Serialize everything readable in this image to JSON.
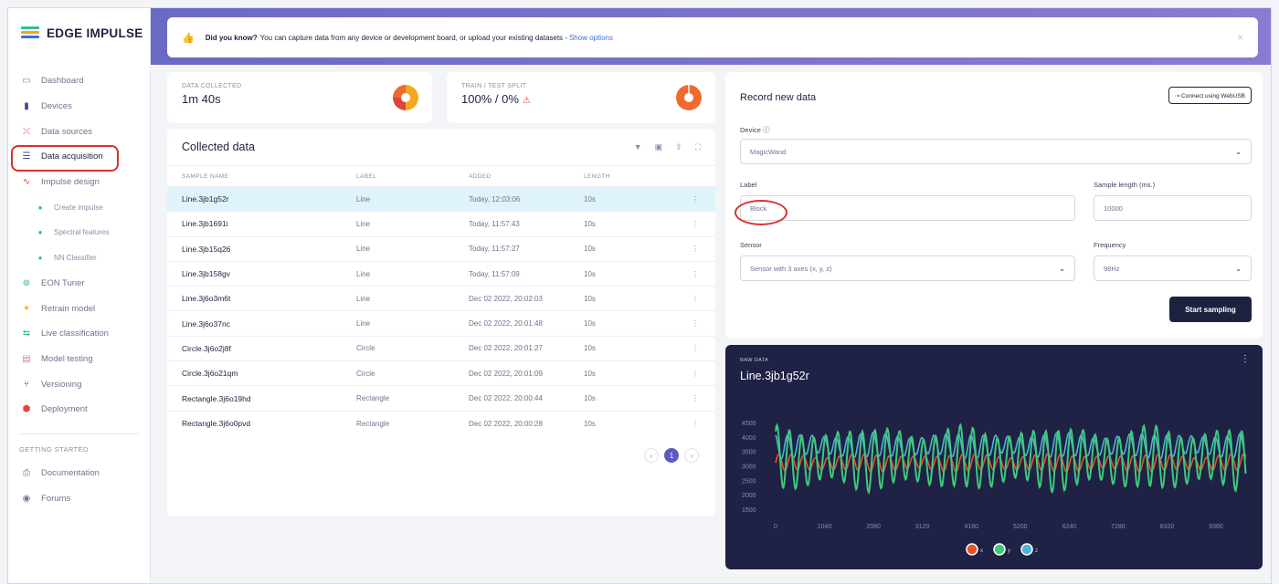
{
  "app": {
    "brand": "EDGE IMPULSE",
    "brand_colors": [
      "#2ec27e",
      "#f5a623",
      "#3b6de0"
    ]
  },
  "sidebar": {
    "items": [
      {
        "label": "Dashboard",
        "icon": "monitor-icon",
        "glyph": "▭",
        "color": "#3b9be0"
      },
      {
        "label": "Devices",
        "icon": "device-icon",
        "glyph": "▮",
        "color": "#3f4a9a"
      },
      {
        "label": "Data sources",
        "icon": "data-sources-icon",
        "glyph": "⤫",
        "color": "#e0443a"
      },
      {
        "label": "Data acquisition",
        "icon": "database-icon",
        "glyph": "☰",
        "color": "#3f4a9a",
        "active": true
      },
      {
        "label": "Impulse design",
        "icon": "pulse-icon",
        "glyph": "∿",
        "color": "#e0443a"
      },
      {
        "label": "Create impulse",
        "icon": "dot-icon",
        "glyph": "●",
        "sub": true
      },
      {
        "label": "Spectral features",
        "icon": "dot-icon",
        "glyph": "●",
        "sub": true
      },
      {
        "label": "NN Classifier",
        "icon": "dot-icon",
        "glyph": "●",
        "sub": true
      },
      {
        "label": "EON Tuner",
        "icon": "tuner-icon",
        "glyph": "⊚",
        "color": "#2ec27e"
      },
      {
        "label": "Retrain model",
        "icon": "retrain-icon",
        "glyph": "✶",
        "color": "#f5a623"
      },
      {
        "label": "Live classification",
        "icon": "live-icon",
        "glyph": "⇆",
        "color": "#2ec27e"
      },
      {
        "label": "Model testing",
        "icon": "testing-icon",
        "glyph": "▤",
        "color": "#e07aa8"
      },
      {
        "label": "Versioning",
        "icon": "versioning-icon",
        "glyph": "⑂",
        "color": "#3f4a9a"
      },
      {
        "label": "Deployment",
        "icon": "deploy-icon",
        "glyph": "⬢",
        "color": "#e0443a"
      }
    ],
    "section": "GETTING STARTED",
    "footer_items": [
      {
        "label": "Documentation",
        "icon": "book-icon",
        "glyph": "⎙",
        "color": "#6f7390"
      },
      {
        "label": "Forums",
        "icon": "forum-icon",
        "glyph": "◉",
        "color": "#6f7390"
      }
    ]
  },
  "banner": {
    "bold": "Did you know?",
    "text": "You can capture data from any device or development board, or upload your existing datasets -",
    "link": "Show options",
    "close": "×"
  },
  "stats": {
    "collected": {
      "label": "DATA COLLECTED",
      "value": "1m 40s",
      "pie": [
        {
          "share": 0.5,
          "color": "#f5a623"
        },
        {
          "share": 0.25,
          "color": "#e0443a"
        },
        {
          "share": 0.25,
          "color": "#f06a2e"
        }
      ]
    },
    "split": {
      "label": "TRAIN / TEST SPLIT",
      "value": "100% / 0%",
      "warning": "⚠",
      "color": "#f06a2e"
    }
  },
  "collected": {
    "title": "Collected data",
    "tools": [
      "▼",
      "▣",
      "⇪",
      "⛶"
    ],
    "tool_icons": [
      "filter-icon",
      "select-icon",
      "upload-icon",
      "expand-icon"
    ],
    "columns": [
      "SAMPLE NAME",
      "LABEL",
      "ADDED",
      "LENGTH"
    ],
    "rows": [
      {
        "name": "Line.3jb1g52r",
        "label": "Line",
        "added": "Today, 12:03:06",
        "length": "10s",
        "selected": true
      },
      {
        "name": "Line.3jb1691i",
        "label": "Line",
        "added": "Today, 11:57:43",
        "length": "10s"
      },
      {
        "name": "Line.3jb15q26",
        "label": "Line",
        "added": "Today, 11:57:27",
        "length": "10s"
      },
      {
        "name": "Line.3jb158gv",
        "label": "Line",
        "added": "Today, 11:57:09",
        "length": "10s"
      },
      {
        "name": "Line.3j6o3m6t",
        "label": "Line",
        "added": "Dec 02 2022, 20:02:03",
        "length": "10s"
      },
      {
        "name": "Line.3j6o37nc",
        "label": "Line",
        "added": "Dec 02 2022, 20:01:48",
        "length": "10s"
      },
      {
        "name": "Circle.3j6o2j8f",
        "label": "Circle",
        "added": "Dec 02 2022, 20:01:27",
        "length": "10s"
      },
      {
        "name": "Circle.3j6o21qm",
        "label": "Circle",
        "added": "Dec 02 2022, 20:01:09",
        "length": "10s"
      },
      {
        "name": "Rectangle.3j6o19hd",
        "label": "Rectangle",
        "added": "Dec 02 2022, 20:00:44",
        "length": "10s"
      },
      {
        "name": "Rectangle.3j6o0pvd",
        "label": "Rectangle",
        "added": "Dec 02 2022, 20:00:28",
        "length": "10s"
      }
    ],
    "row_menu": "⋮",
    "pager": {
      "prev": "‹",
      "current": "1",
      "next": "›"
    }
  },
  "record": {
    "title": "Record new data",
    "webusb": "⇢ Connect using WebUSB",
    "device_label": "Device ⓘ",
    "device_value": "MagicWand",
    "label_label": "Label",
    "label_value": "Block",
    "length_label": "Sample length (ms.)",
    "length_value": "10000",
    "sensor_label": "Sensor",
    "sensor_value": "Sensor with 3 axes (x, y, z)",
    "freq_label": "Frequency",
    "freq_value": "98Hz",
    "start": "Start sampling",
    "caret": "⌄"
  },
  "raw": {
    "label": "RAW DATA",
    "name": "Line.3jb1g52r",
    "menu": "⋮"
  },
  "chart_data": {
    "type": "line",
    "x_ticks": [
      0,
      1040,
      2080,
      3120,
      4160,
      5200,
      6240,
      7280,
      8320,
      9360
    ],
    "y_ticks": [
      4500,
      4000,
      3500,
      3000,
      2500,
      2000,
      1500
    ],
    "xlim": [
      0,
      10000
    ],
    "ylim": [
      1500,
      4500
    ],
    "series": [
      {
        "name": "x",
        "color": "#e8542a",
        "baseline": 3100,
        "amplitude": 250,
        "period_ms": 260
      },
      {
        "name": "y",
        "color": "#3ec97a",
        "baseline": 3250,
        "amplitude": 900,
        "period_ms": 260
      },
      {
        "name": "z",
        "color": "#4fb3d8",
        "baseline": 3700,
        "amplitude": 350,
        "period_ms": 260
      }
    ]
  }
}
